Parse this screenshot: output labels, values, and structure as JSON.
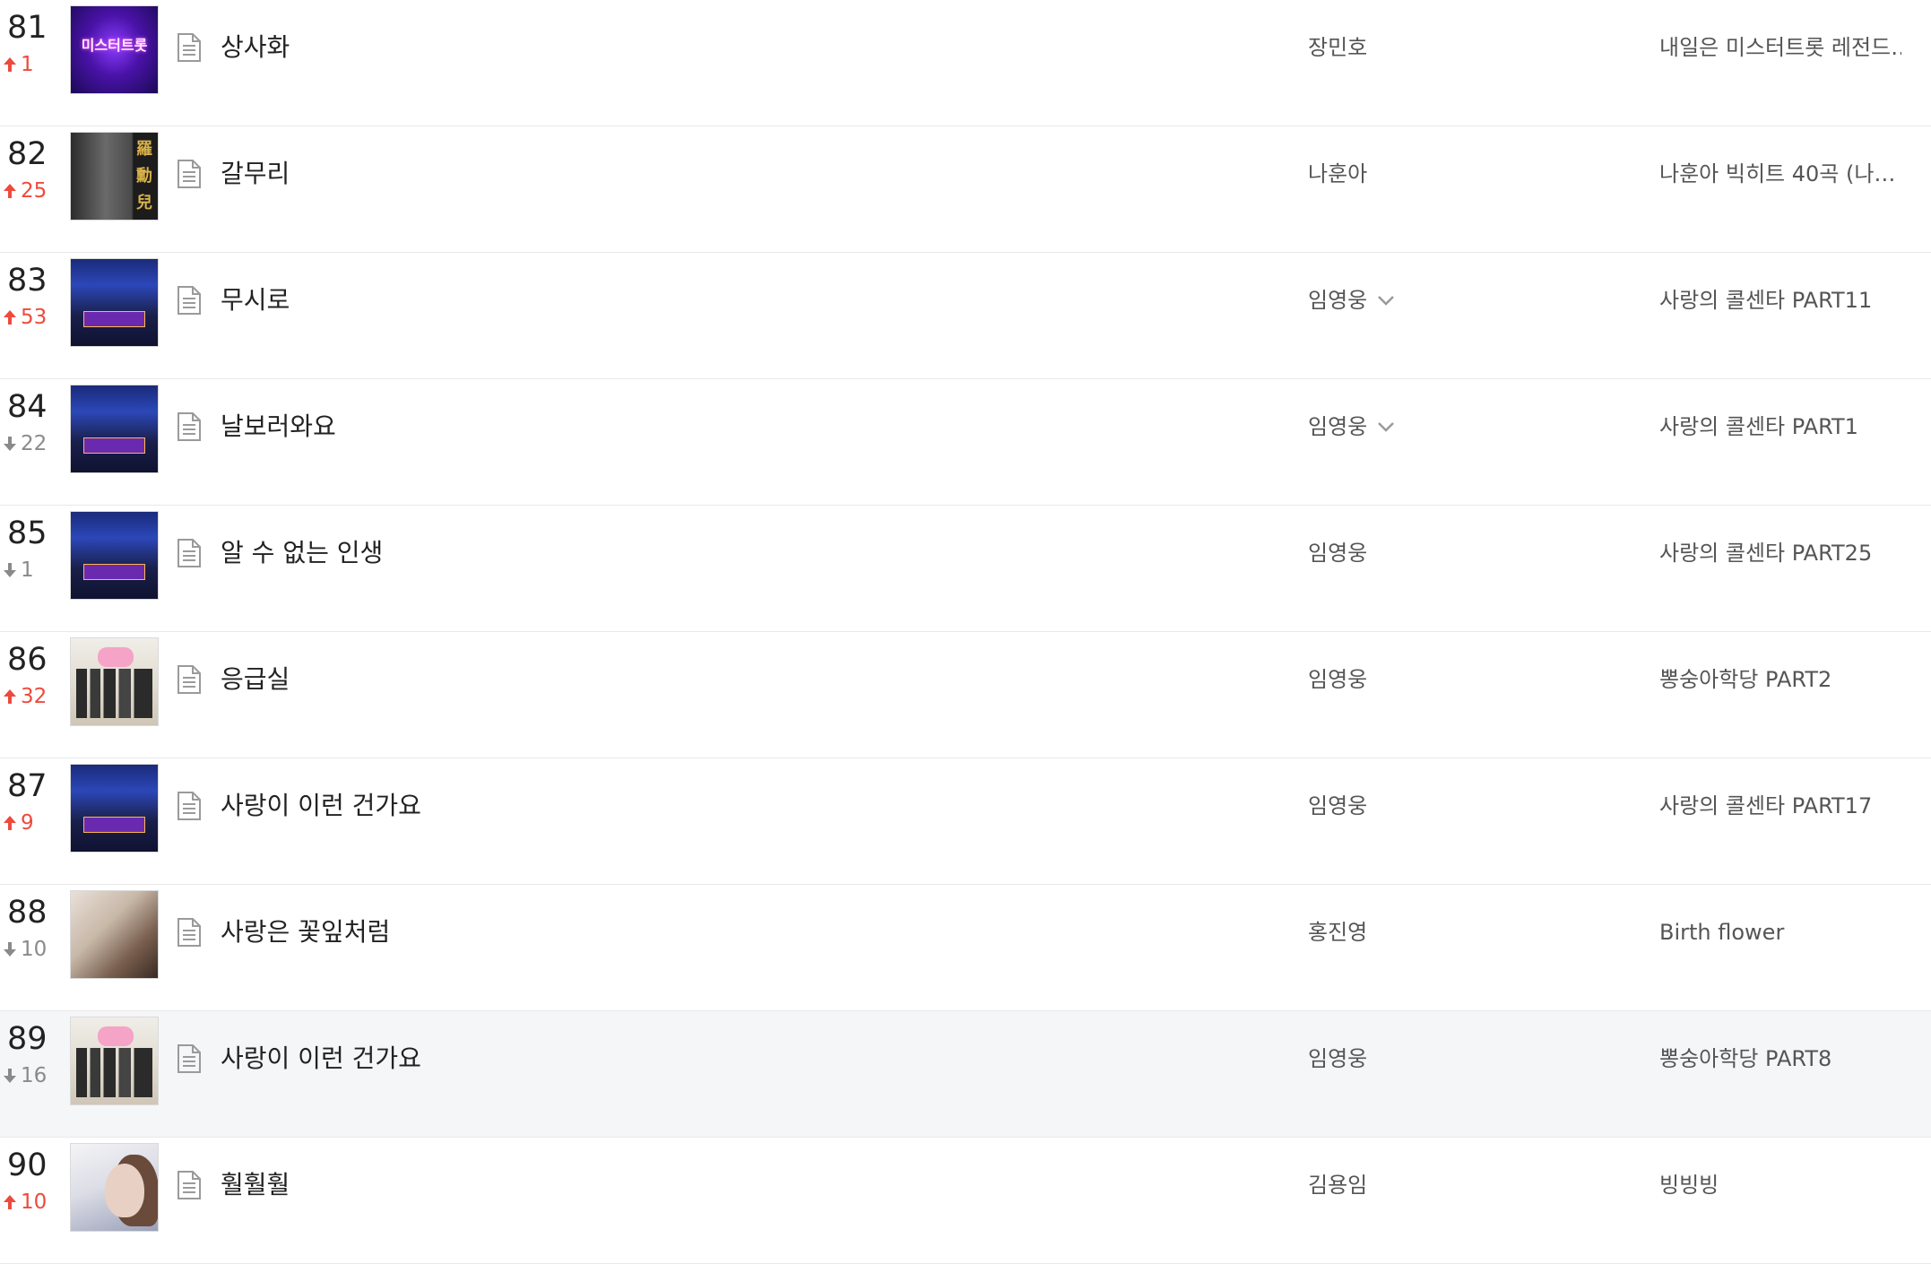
{
  "colors": {
    "rank_up": "#ee4a3c",
    "rank_down": "#8a8a8a",
    "highlight_row": "#f5f6f8"
  },
  "rows": [
    {
      "rank": "81",
      "direction": "up",
      "change": "1",
      "art": "mist",
      "art_text": "미스터트롯",
      "title": "상사화",
      "artist": "장민호",
      "artist_more": false,
      "album": "내일은 미스터트롯 레전드…"
    },
    {
      "rank": "82",
      "direction": "up",
      "change": "25",
      "art": "nah",
      "art_text": "羅勳兒",
      "title": "갈무리",
      "artist": "나훈아",
      "artist_more": false,
      "album": "나훈아 빅히트 40곡 (나…"
    },
    {
      "rank": "83",
      "direction": "up",
      "change": "53",
      "art": "call",
      "art_text": "",
      "title": "무시로",
      "artist": "임영웅",
      "artist_more": true,
      "album": "사랑의 콜센타 PART11"
    },
    {
      "rank": "84",
      "direction": "down",
      "change": "22",
      "art": "call",
      "art_text": "",
      "title": "날보러와요",
      "artist": "임영웅",
      "artist_more": true,
      "album": "사랑의 콜센타 PART1"
    },
    {
      "rank": "85",
      "direction": "down",
      "change": "1",
      "art": "call",
      "art_text": "",
      "title": "알 수 없는 인생",
      "artist": "임영웅",
      "artist_more": false,
      "album": "사랑의 콜센타 PART25"
    },
    {
      "rank": "86",
      "direction": "up",
      "change": "32",
      "art": "ppong",
      "art_text": "",
      "title": "응급실",
      "artist": "임영웅",
      "artist_more": false,
      "album": "뽕숭아학당 PART2"
    },
    {
      "rank": "87",
      "direction": "up",
      "change": "9",
      "art": "call",
      "art_text": "",
      "title": "사랑이 이런 건가요",
      "artist": "임영웅",
      "artist_more": false,
      "album": "사랑의 콜센타 PART17"
    },
    {
      "rank": "88",
      "direction": "down",
      "change": "10",
      "art": "birth",
      "art_text": "",
      "title": "사랑은 꽃잎처럼",
      "artist": "홍진영",
      "artist_more": false,
      "album": "Birth flower"
    },
    {
      "rank": "89",
      "direction": "down",
      "change": "16",
      "art": "ppong",
      "art_text": "",
      "title": "사랑이 이런 건가요",
      "artist": "임영웅",
      "artist_more": false,
      "album": "뽕숭아학당 PART8",
      "highlight": true
    },
    {
      "rank": "90",
      "direction": "up",
      "change": "10",
      "art": "bing",
      "art_text": "",
      "title": "훨훨훨",
      "artist": "김용임",
      "artist_more": false,
      "album": "빙빙빙"
    }
  ]
}
